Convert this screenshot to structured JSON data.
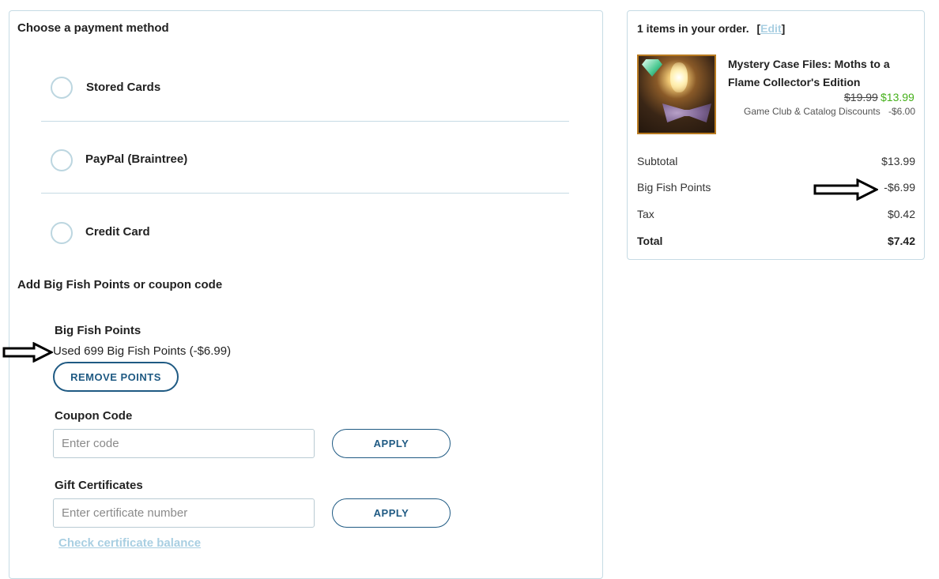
{
  "payment": {
    "title": "Choose a payment method",
    "options": [
      {
        "label": "Stored Cards"
      },
      {
        "label": "PayPal (Braintree)"
      },
      {
        "label": "Credit Card"
      }
    ]
  },
  "points_coupon": {
    "title": "Add Big Fish Points or coupon code",
    "points_title": "Big Fish Points",
    "points_used": "Used 699 Big Fish Points (-$6.99)",
    "remove_label": "REMOVE POINTS",
    "coupon_title": "Coupon Code",
    "coupon_placeholder": "Enter code",
    "coupon_apply": "APPLY",
    "gift_title": "Gift Certificates",
    "gift_placeholder": "Enter certificate number",
    "gift_apply": "APPLY",
    "check_balance": "Check certificate balance"
  },
  "order": {
    "heading": "1 items in your order.",
    "bracket_open": "[",
    "edit": "Edit",
    "bracket_close": "]",
    "product": {
      "title": "Mystery Case Files: Moths to a Flame Collector's Edition",
      "price_old": "$19.99",
      "price_new": "$13.99",
      "discount_label": "Game Club & Catalog Discounts",
      "discount_value": "-$6.00"
    },
    "summary": {
      "subtotal_label": "Subtotal",
      "subtotal_value": "$13.99",
      "points_label": "Big Fish Points",
      "points_value": "-$6.99",
      "tax_label": "Tax",
      "tax_value": "$0.42",
      "total_label": "Total",
      "total_value": "$7.42"
    }
  },
  "icons": {
    "radio": "radio-circle-icon",
    "arrow": "right-arrow-icon"
  },
  "colors": {
    "accent": "#1f5a83",
    "link": "#a9cfe2",
    "sale_price": "#45b01a",
    "border": "#c6dbe4"
  }
}
